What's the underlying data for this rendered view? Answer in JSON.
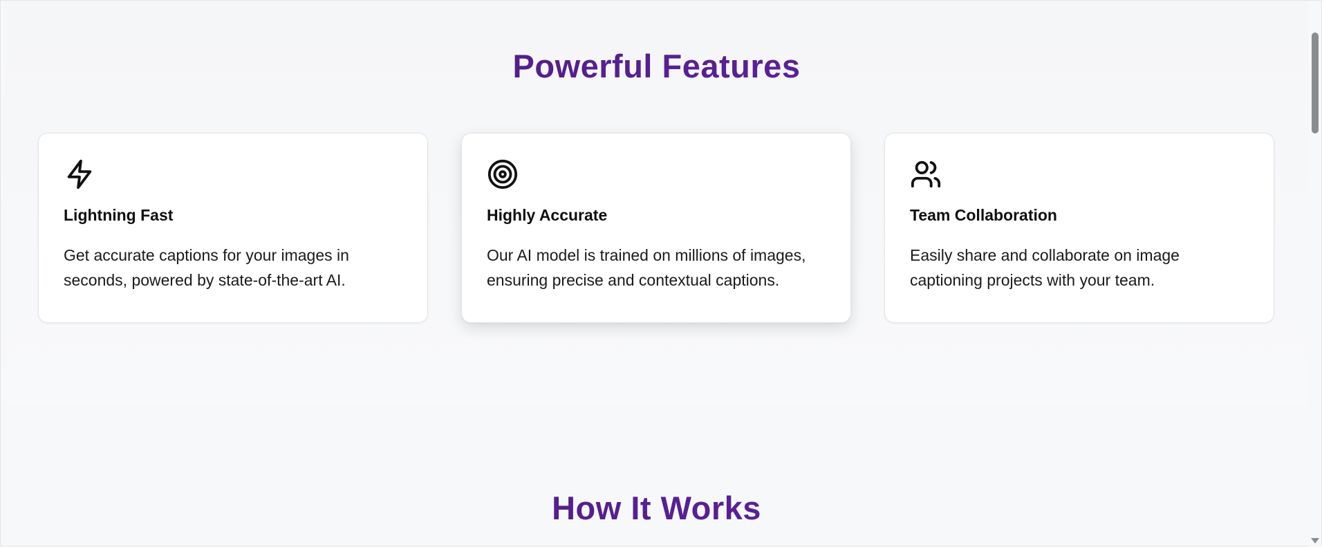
{
  "features": {
    "title": "Powerful Features",
    "cards": [
      {
        "icon": "lightning-icon",
        "title": "Lightning Fast",
        "text": "Get accurate captions for your images in seconds, powered by state-of-the-art AI."
      },
      {
        "icon": "target-icon",
        "title": "Highly Accurate",
        "text": "Our AI model is trained on millions of images, ensuring precise and contextual captions."
      },
      {
        "icon": "users-icon",
        "title": "Team Collaboration",
        "text": "Easily share and collaborate on image captioning projects with your team."
      }
    ]
  },
  "how_it_works": {
    "title": "How It Works"
  },
  "colors": {
    "heading": "#4c1d7a",
    "card_bg": "#ffffff",
    "page_bg": "#f7f8fa"
  }
}
